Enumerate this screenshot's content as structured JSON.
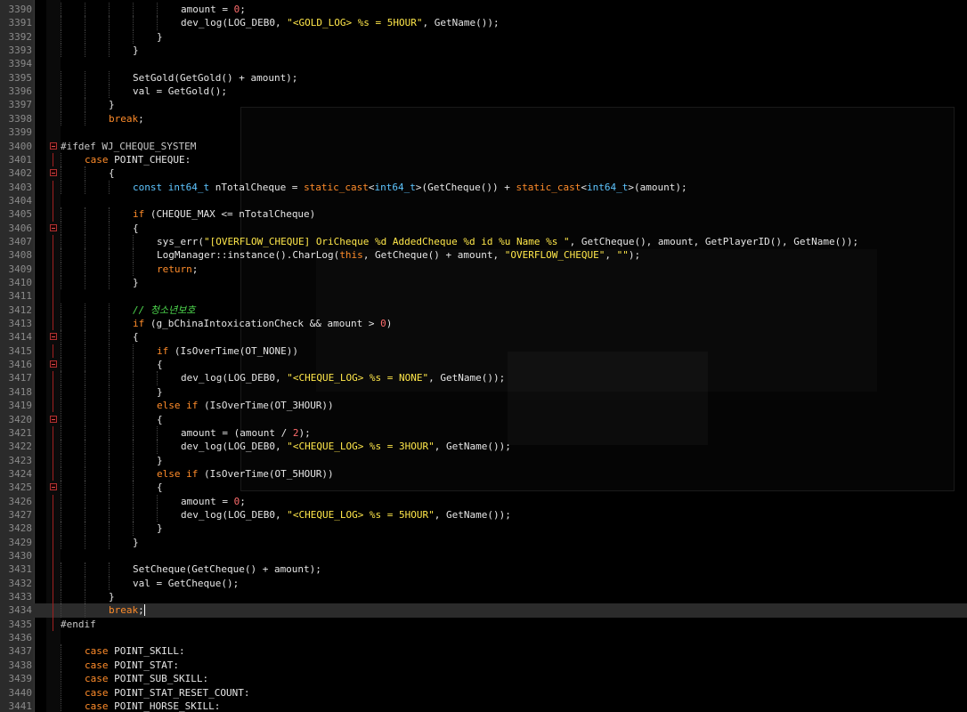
{
  "editor": {
    "lines": [
      {
        "n": "3390",
        "indent": 5,
        "parts": [
          [
            "",
            "amount = "
          ],
          [
            "num",
            "0"
          ],
          [
            "",
            ";"
          ]
        ]
      },
      {
        "n": "3391",
        "indent": 5,
        "parts": [
          [
            "",
            "dev_log(LOG_DEB0, "
          ],
          [
            "str",
            "\"<GOLD_LOG> %s = 5HOUR\""
          ],
          [
            "",
            ", GetName());"
          ]
        ]
      },
      {
        "n": "3392",
        "indent": 4,
        "parts": [
          [
            "",
            "}"
          ]
        ]
      },
      {
        "n": "3393",
        "indent": 3,
        "parts": [
          [
            "",
            "}"
          ]
        ]
      },
      {
        "n": "3394",
        "indent": 0,
        "parts": []
      },
      {
        "n": "3395",
        "indent": 3,
        "parts": [
          [
            "",
            "SetGold(GetGold() + amount);"
          ]
        ]
      },
      {
        "n": "3396",
        "indent": 3,
        "parts": [
          [
            "",
            "val = GetGold();"
          ]
        ]
      },
      {
        "n": "3397",
        "indent": 2,
        "parts": [
          [
            "",
            "}"
          ]
        ]
      },
      {
        "n": "3398",
        "indent": 2,
        "parts": [
          [
            "kw",
            "break"
          ],
          [
            "",
            ";"
          ]
        ]
      },
      {
        "n": "3399",
        "indent": 0,
        "parts": []
      },
      {
        "n": "3400",
        "indent": 0,
        "fold": true,
        "parts": [
          [
            "pp",
            "#ifdef WJ_CHEQUE_SYSTEM"
          ]
        ]
      },
      {
        "n": "3401",
        "indent": 1,
        "parts": [
          [
            "kw",
            "case"
          ],
          [
            "",
            " POINT_CHEQUE:"
          ]
        ]
      },
      {
        "n": "3402",
        "indent": 2,
        "fold": true,
        "parts": [
          [
            "",
            "{"
          ]
        ]
      },
      {
        "n": "3403",
        "indent": 3,
        "parts": [
          [
            "blue",
            "const int64_t"
          ],
          [
            "",
            " nTotalCheque = "
          ],
          [
            "kw",
            "static_cast"
          ],
          [
            "",
            "<"
          ],
          [
            "blue",
            "int64_t"
          ],
          [
            "",
            ">(GetCheque()) + "
          ],
          [
            "kw",
            "static_cast"
          ],
          [
            "",
            "<"
          ],
          [
            "blue",
            "int64_t"
          ],
          [
            "",
            ">(amount);"
          ]
        ]
      },
      {
        "n": "3404",
        "indent": 0,
        "parts": []
      },
      {
        "n": "3405",
        "indent": 3,
        "parts": [
          [
            "kw",
            "if"
          ],
          [
            "",
            " (CHEQUE_MAX <= nTotalCheque)"
          ]
        ]
      },
      {
        "n": "3406",
        "indent": 3,
        "fold": true,
        "parts": [
          [
            "",
            "{"
          ]
        ]
      },
      {
        "n": "3407",
        "indent": 4,
        "parts": [
          [
            "",
            "sys_err("
          ],
          [
            "str",
            "\"[OVERFLOW_CHEQUE] OriCheque %d AddedCheque %d id %u Name %s \""
          ],
          [
            "",
            ", GetCheque(), amount, GetPlayerID(), GetName());"
          ]
        ]
      },
      {
        "n": "3408",
        "indent": 4,
        "parts": [
          [
            "",
            "LogManager::instance().CharLog("
          ],
          [
            "kw",
            "this"
          ],
          [
            "",
            ", GetCheque() + amount, "
          ],
          [
            "str",
            "\"OVERFLOW_CHEQUE\""
          ],
          [
            "",
            ", "
          ],
          [
            "str",
            "\"\""
          ],
          [
            "",
            ");"
          ]
        ]
      },
      {
        "n": "3409",
        "indent": 4,
        "parts": [
          [
            "kw",
            "return"
          ],
          [
            "",
            ";"
          ]
        ]
      },
      {
        "n": "3410",
        "indent": 3,
        "parts": [
          [
            "",
            "}"
          ]
        ]
      },
      {
        "n": "3411",
        "indent": 0,
        "parts": []
      },
      {
        "n": "3412",
        "indent": 3,
        "parts": [
          [
            "cm",
            "// 청소년보호"
          ]
        ]
      },
      {
        "n": "3413",
        "indent": 3,
        "parts": [
          [
            "kw",
            "if"
          ],
          [
            "",
            " (g_bChinaIntoxicationCheck && amount > "
          ],
          [
            "num",
            "0"
          ],
          [
            "",
            ")"
          ]
        ]
      },
      {
        "n": "3414",
        "indent": 3,
        "fold": true,
        "parts": [
          [
            "",
            "{"
          ]
        ]
      },
      {
        "n": "3415",
        "indent": 4,
        "parts": [
          [
            "kw",
            "if"
          ],
          [
            "",
            " (IsOverTime(OT_NONE))"
          ]
        ]
      },
      {
        "n": "3416",
        "indent": 4,
        "fold": true,
        "parts": [
          [
            "",
            "{"
          ]
        ]
      },
      {
        "n": "3417",
        "indent": 5,
        "parts": [
          [
            "",
            "dev_log(LOG_DEB0, "
          ],
          [
            "str",
            "\"<CHEQUE_LOG> %s = NONE\""
          ],
          [
            "",
            ", GetName());"
          ]
        ]
      },
      {
        "n": "3418",
        "indent": 4,
        "parts": [
          [
            "",
            "}"
          ]
        ]
      },
      {
        "n": "3419",
        "indent": 4,
        "parts": [
          [
            "kw",
            "else if"
          ],
          [
            "",
            " (IsOverTime(OT_3HOUR))"
          ]
        ]
      },
      {
        "n": "3420",
        "indent": 4,
        "fold": true,
        "parts": [
          [
            "",
            "{"
          ]
        ]
      },
      {
        "n": "3421",
        "indent": 5,
        "parts": [
          [
            "",
            "amount = (amount / "
          ],
          [
            "num",
            "2"
          ],
          [
            "",
            ");"
          ]
        ]
      },
      {
        "n": "3422",
        "indent": 5,
        "parts": [
          [
            "",
            "dev_log(LOG_DEB0, "
          ],
          [
            "str",
            "\"<CHEQUE_LOG> %s = 3HOUR\""
          ],
          [
            "",
            ", GetName());"
          ]
        ]
      },
      {
        "n": "3423",
        "indent": 4,
        "parts": [
          [
            "",
            "}"
          ]
        ]
      },
      {
        "n": "3424",
        "indent": 4,
        "parts": [
          [
            "kw",
            "else if"
          ],
          [
            "",
            " (IsOverTime(OT_5HOUR))"
          ]
        ]
      },
      {
        "n": "3425",
        "indent": 4,
        "fold": true,
        "parts": [
          [
            "",
            "{"
          ]
        ]
      },
      {
        "n": "3426",
        "indent": 5,
        "parts": [
          [
            "",
            "amount = "
          ],
          [
            "num",
            "0"
          ],
          [
            "",
            ";"
          ]
        ]
      },
      {
        "n": "3427",
        "indent": 5,
        "parts": [
          [
            "",
            "dev_log(LOG_DEB0, "
          ],
          [
            "str",
            "\"<CHEQUE_LOG> %s = 5HOUR\""
          ],
          [
            "",
            ", GetName());"
          ]
        ]
      },
      {
        "n": "3428",
        "indent": 4,
        "parts": [
          [
            "",
            "}"
          ]
        ]
      },
      {
        "n": "3429",
        "indent": 3,
        "parts": [
          [
            "",
            "}"
          ]
        ]
      },
      {
        "n": "3430",
        "indent": 0,
        "parts": []
      },
      {
        "n": "3431",
        "indent": 3,
        "parts": [
          [
            "",
            "SetCheque(GetCheque() + amount);"
          ]
        ]
      },
      {
        "n": "3432",
        "indent": 3,
        "parts": [
          [
            "",
            "val = GetCheque();"
          ]
        ]
      },
      {
        "n": "3433",
        "indent": 2,
        "parts": [
          [
            "",
            "}"
          ]
        ]
      },
      {
        "n": "3434",
        "indent": 2,
        "current": true,
        "parts": [
          [
            "kw",
            "break"
          ],
          [
            "",
            ";"
          ]
        ]
      },
      {
        "n": "3435",
        "indent": 0,
        "parts": [
          [
            "pp",
            "#endif"
          ]
        ]
      },
      {
        "n": "3436",
        "indent": 0,
        "parts": []
      },
      {
        "n": "3437",
        "indent": 1,
        "parts": [
          [
            "kw",
            "case"
          ],
          [
            "",
            " POINT_SKILL:"
          ]
        ]
      },
      {
        "n": "3438",
        "indent": 1,
        "parts": [
          [
            "kw",
            "case"
          ],
          [
            "",
            " POINT_STAT:"
          ]
        ]
      },
      {
        "n": "3439",
        "indent": 1,
        "parts": [
          [
            "kw",
            "case"
          ],
          [
            "",
            " POINT_SUB_SKILL:"
          ]
        ]
      },
      {
        "n": "3440",
        "indent": 1,
        "parts": [
          [
            "kw",
            "case"
          ],
          [
            "",
            " POINT_STAT_RESET_COUNT:"
          ]
        ]
      },
      {
        "n": "3441",
        "indent": 1,
        "parts": [
          [
            "kw",
            "case"
          ],
          [
            "",
            " POINT_HORSE_SKILL:"
          ]
        ]
      }
    ]
  },
  "colors": {
    "keyword": "#ff8c2a",
    "type": "#5ec5ff",
    "string": "#ffe74a",
    "number": "#ff6d6d",
    "comment": "#4fdc4f",
    "text": "#e6e6e6"
  }
}
